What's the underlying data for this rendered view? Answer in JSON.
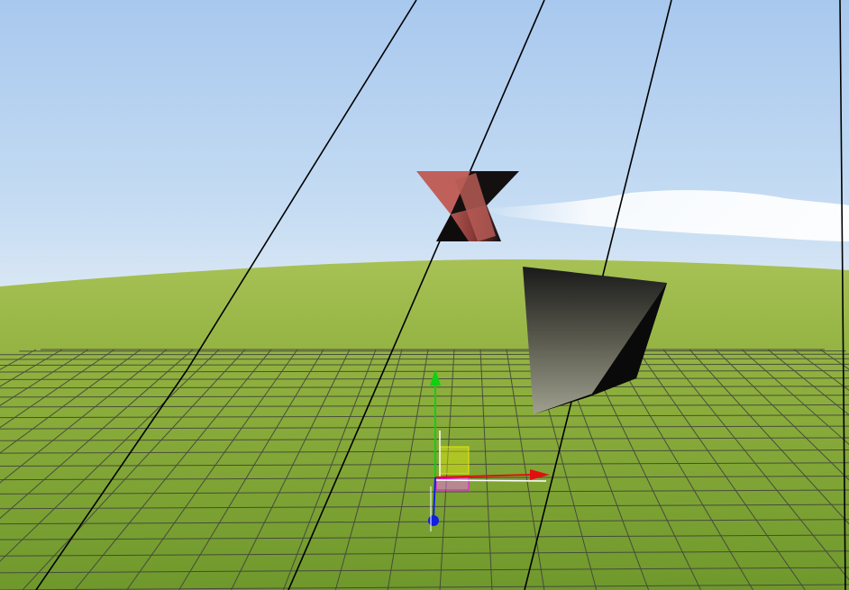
{
  "scene": {
    "background": "sky-and-grass-skybox",
    "objects": [
      {
        "name": "twisted-hourglass-mesh",
        "color": "#b85a55"
      },
      {
        "name": "black-pyramid-mesh",
        "color": "#202020"
      },
      {
        "name": "ground-grid-helper",
        "color": "#4a4a4a"
      },
      {
        "name": "transform-gizmo",
        "axes": [
          "x",
          "y",
          "z"
        ]
      }
    ],
    "colors": {
      "sky_top": "#a9c8ee",
      "sky_bottom": "#d6e6f5",
      "grass_far": "#9fbd4c",
      "grass_near": "#6f9a2a",
      "axis_x": "#e01010",
      "axis_y": "#10d010",
      "axis_z": "#1020e0"
    }
  }
}
